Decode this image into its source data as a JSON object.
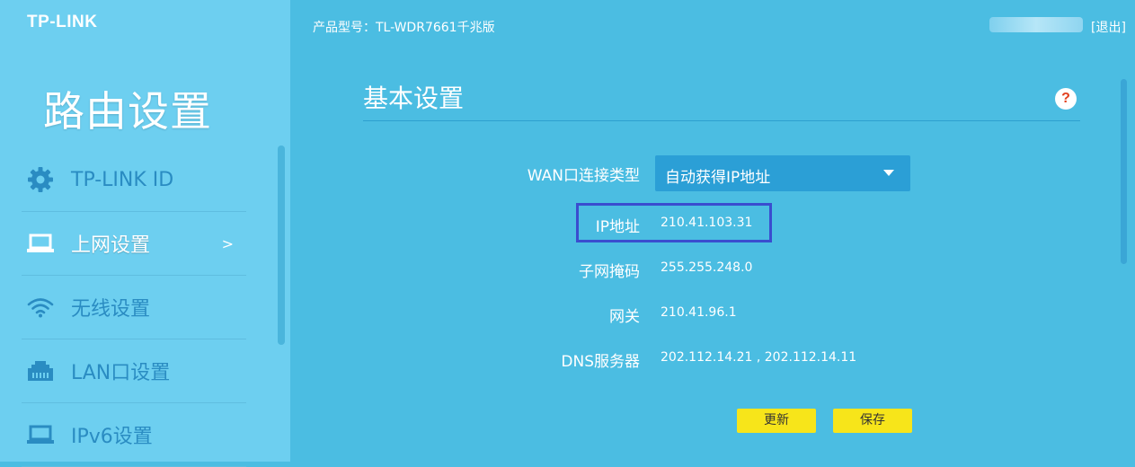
{
  "brand": {
    "logo": "TP-LINK"
  },
  "sidebar": {
    "title": "路由设置",
    "items": [
      {
        "label": "TP-LINK ID",
        "icon": "gear-icon"
      },
      {
        "label": "上网设置",
        "icon": "laptop-icon",
        "arrow": ">",
        "active": true
      },
      {
        "label": "无线设置",
        "icon": "wifi-icon"
      },
      {
        "label": "LAN口设置",
        "icon": "lan-port-icon"
      },
      {
        "label": "IPv6设置",
        "icon": "laptop-icon"
      }
    ]
  },
  "header": {
    "model": "产品型号：TL-WDR7661千兆版",
    "logout": "[退出]"
  },
  "main": {
    "title": "基本设置",
    "help": "?",
    "wan_type_label": "WAN口连接类型",
    "wan_type_value": "自动获得IP地址",
    "ip_label": "IP地址",
    "ip_value": "210.41.103.31",
    "subnet_label": "子网掩码",
    "subnet_value": "255.255.248.0",
    "gateway_label": "网关",
    "gateway_value": "210.41.96.1",
    "dns_label": "DNS服务器",
    "dns_value": "202.112.14.21 , 202.112.14.11",
    "refresh_button": "更新",
    "save_button": "保存"
  },
  "colors": {
    "sidebar_bg": "#6dcff0",
    "main_bg": "#4bbde2",
    "button_yellow": "#f7e51a",
    "highlight_border": "#3a4dcf"
  }
}
